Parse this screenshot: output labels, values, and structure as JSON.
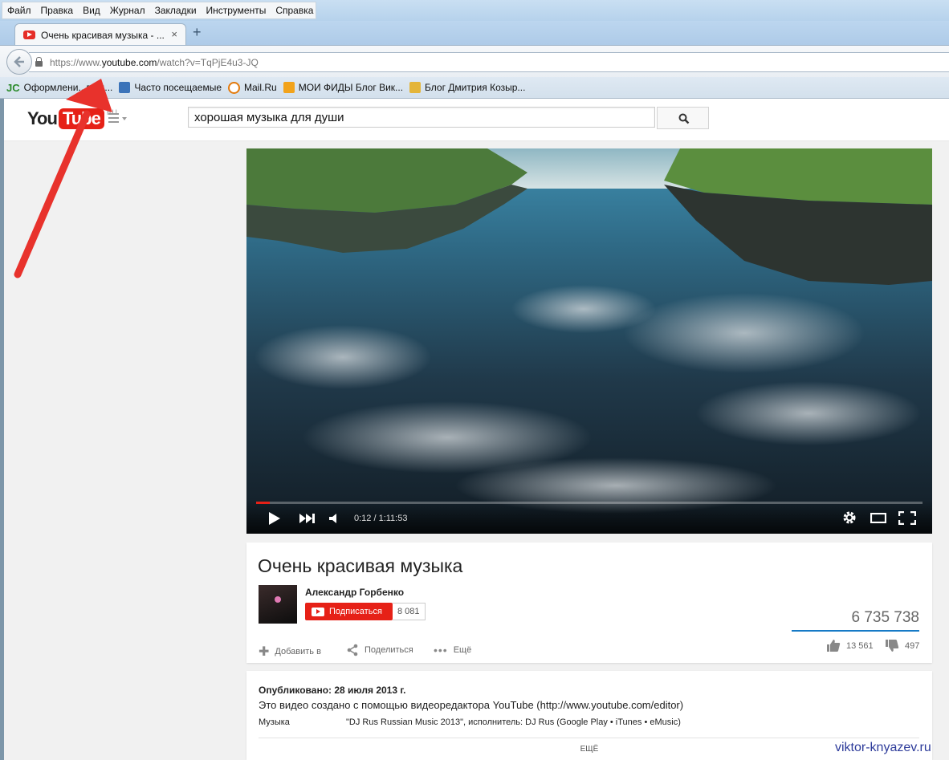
{
  "browser": {
    "menu": [
      "Файл",
      "Правка",
      "Вид",
      "Журнал",
      "Закладки",
      "Инструменты",
      "Справка"
    ],
    "tab_title": "Очень красивая музыка - ...",
    "tab_close": "×",
    "new_tab": "+",
    "url_prefix": "https://www.",
    "url_domain": "youtube.com",
    "url_path": "/watch?v=TqPjE4u3-JQ",
    "bookmarks": [
      {
        "label": "Оформлени...ва ::...",
        "icon": "jc-icon"
      },
      {
        "label": "Часто посещаемые",
        "icon": "search-folder-icon"
      },
      {
        "label": "Mail.Ru",
        "icon": "mailru-icon"
      },
      {
        "label": "МОИ ФИДЫ Блог Вик...",
        "icon": "rss-icon"
      },
      {
        "label": "Блог Дмитрия Козыр...",
        "icon": "rss-icon"
      }
    ]
  },
  "youtube": {
    "logo_you": "You",
    "logo_tube": "Tube",
    "logo_region": "RU",
    "search_query": "хорошая музыка для души",
    "player": {
      "time": "0:12 / 1:11:53",
      "progress": 0.003
    },
    "video": {
      "title": "Очень красивая музыка",
      "channel": "Александр Горбенко",
      "subscribe_label": "Подписаться",
      "subscriber_count": "8 081",
      "views": "6 735 738",
      "add_label": "Добавить в",
      "share_label": "Поделиться",
      "more_label": "Ещё",
      "likes": "13 561",
      "dislikes": "497"
    },
    "description": {
      "published": "Опубликовано: 28 июля 2013 г.",
      "text": "Это видео создано с помощью видеоредактора YouTube (http://www.youtube.com/editor)",
      "music_label": "Музыка",
      "music_value": "\"DJ Rus Russian Music 2013\", исполнитель: DJ Rus (Google Play • iTunes • eMusic)",
      "show_more": "ЕЩЁ"
    }
  },
  "watermark": "viktor-knyazev.ru",
  "colors": {
    "accent": "#e62117",
    "arrow": "#e8322c",
    "progress": "#167ac6"
  }
}
